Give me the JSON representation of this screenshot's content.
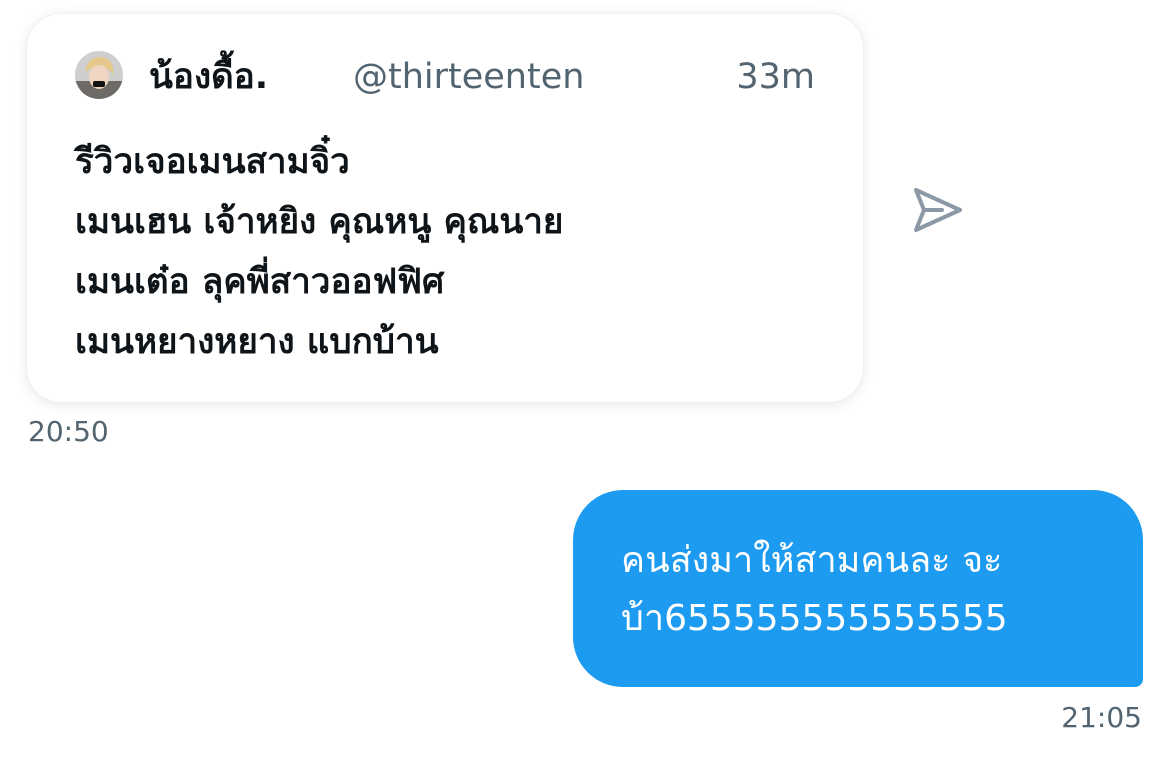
{
  "messages": {
    "shared_tweet": {
      "author_name": "น้องดื้อ.",
      "author_handle": "@thirteenten",
      "age": "33m",
      "lines": [
        "รีวิวเจอเมนสามจิ๋ว",
        "เมนเฮน เจ้าหยิง คุณหนู คุณนาย",
        "เมนเต๋อ ลุคพี่สาวออฟฟิศ",
        "เมนหยางหยาง แบกบ้าน"
      ],
      "sent_time": "20:50",
      "share_icon": "send-paper-plane-icon"
    },
    "reply": {
      "lines": [
        "คนส่งมาให้สามคนละ จะ",
        "บ้า655555555555555"
      ],
      "sent_time": "21:05"
    }
  },
  "colors": {
    "bubble_blue": "#1d9bf0",
    "text_primary": "#0f1419",
    "text_secondary": "#536471",
    "icon_gray": "#8b98a5"
  }
}
